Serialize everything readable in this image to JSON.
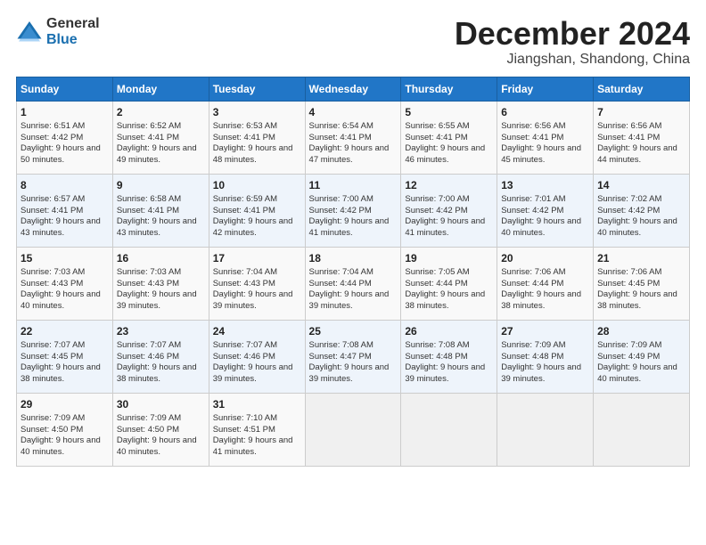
{
  "header": {
    "logo_general": "General",
    "logo_blue": "Blue",
    "month_title": "December 2024",
    "subtitle": "Jiangshan, Shandong, China"
  },
  "days_of_week": [
    "Sunday",
    "Monday",
    "Tuesday",
    "Wednesday",
    "Thursday",
    "Friday",
    "Saturday"
  ],
  "weeks": [
    [
      {
        "day": "1",
        "rise": "6:51 AM",
        "set": "4:42 PM",
        "daylight": "9 hours and 50 minutes."
      },
      {
        "day": "2",
        "rise": "6:52 AM",
        "set": "4:41 PM",
        "daylight": "9 hours and 49 minutes."
      },
      {
        "day": "3",
        "rise": "6:53 AM",
        "set": "4:41 PM",
        "daylight": "9 hours and 48 minutes."
      },
      {
        "day": "4",
        "rise": "6:54 AM",
        "set": "4:41 PM",
        "daylight": "9 hours and 47 minutes."
      },
      {
        "day": "5",
        "rise": "6:55 AM",
        "set": "4:41 PM",
        "daylight": "9 hours and 46 minutes."
      },
      {
        "day": "6",
        "rise": "6:56 AM",
        "set": "4:41 PM",
        "daylight": "9 hours and 45 minutes."
      },
      {
        "day": "7",
        "rise": "6:56 AM",
        "set": "4:41 PM",
        "daylight": "9 hours and 44 minutes."
      }
    ],
    [
      {
        "day": "8",
        "rise": "6:57 AM",
        "set": "4:41 PM",
        "daylight": "9 hours and 43 minutes."
      },
      {
        "day": "9",
        "rise": "6:58 AM",
        "set": "4:41 PM",
        "daylight": "9 hours and 43 minutes."
      },
      {
        "day": "10",
        "rise": "6:59 AM",
        "set": "4:41 PM",
        "daylight": "9 hours and 42 minutes."
      },
      {
        "day": "11",
        "rise": "7:00 AM",
        "set": "4:42 PM",
        "daylight": "9 hours and 41 minutes."
      },
      {
        "day": "12",
        "rise": "7:00 AM",
        "set": "4:42 PM",
        "daylight": "9 hours and 41 minutes."
      },
      {
        "day": "13",
        "rise": "7:01 AM",
        "set": "4:42 PM",
        "daylight": "9 hours and 40 minutes."
      },
      {
        "day": "14",
        "rise": "7:02 AM",
        "set": "4:42 PM",
        "daylight": "9 hours and 40 minutes."
      }
    ],
    [
      {
        "day": "15",
        "rise": "7:03 AM",
        "set": "4:43 PM",
        "daylight": "9 hours and 40 minutes."
      },
      {
        "day": "16",
        "rise": "7:03 AM",
        "set": "4:43 PM",
        "daylight": "9 hours and 39 minutes."
      },
      {
        "day": "17",
        "rise": "7:04 AM",
        "set": "4:43 PM",
        "daylight": "9 hours and 39 minutes."
      },
      {
        "day": "18",
        "rise": "7:04 AM",
        "set": "4:44 PM",
        "daylight": "9 hours and 39 minutes."
      },
      {
        "day": "19",
        "rise": "7:05 AM",
        "set": "4:44 PM",
        "daylight": "9 hours and 38 minutes."
      },
      {
        "day": "20",
        "rise": "7:06 AM",
        "set": "4:44 PM",
        "daylight": "9 hours and 38 minutes."
      },
      {
        "day": "21",
        "rise": "7:06 AM",
        "set": "4:45 PM",
        "daylight": "9 hours and 38 minutes."
      }
    ],
    [
      {
        "day": "22",
        "rise": "7:07 AM",
        "set": "4:45 PM",
        "daylight": "9 hours and 38 minutes."
      },
      {
        "day": "23",
        "rise": "7:07 AM",
        "set": "4:46 PM",
        "daylight": "9 hours and 38 minutes."
      },
      {
        "day": "24",
        "rise": "7:07 AM",
        "set": "4:46 PM",
        "daylight": "9 hours and 39 minutes."
      },
      {
        "day": "25",
        "rise": "7:08 AM",
        "set": "4:47 PM",
        "daylight": "9 hours and 39 minutes."
      },
      {
        "day": "26",
        "rise": "7:08 AM",
        "set": "4:48 PM",
        "daylight": "9 hours and 39 minutes."
      },
      {
        "day": "27",
        "rise": "7:09 AM",
        "set": "4:48 PM",
        "daylight": "9 hours and 39 minutes."
      },
      {
        "day": "28",
        "rise": "7:09 AM",
        "set": "4:49 PM",
        "daylight": "9 hours and 40 minutes."
      }
    ],
    [
      {
        "day": "29",
        "rise": "7:09 AM",
        "set": "4:50 PM",
        "daylight": "9 hours and 40 minutes."
      },
      {
        "day": "30",
        "rise": "7:09 AM",
        "set": "4:50 PM",
        "daylight": "9 hours and 40 minutes."
      },
      {
        "day": "31",
        "rise": "7:10 AM",
        "set": "4:51 PM",
        "daylight": "9 hours and 41 minutes."
      },
      null,
      null,
      null,
      null
    ]
  ],
  "labels": {
    "sunrise": "Sunrise:",
    "sunset": "Sunset:",
    "daylight": "Daylight:"
  }
}
